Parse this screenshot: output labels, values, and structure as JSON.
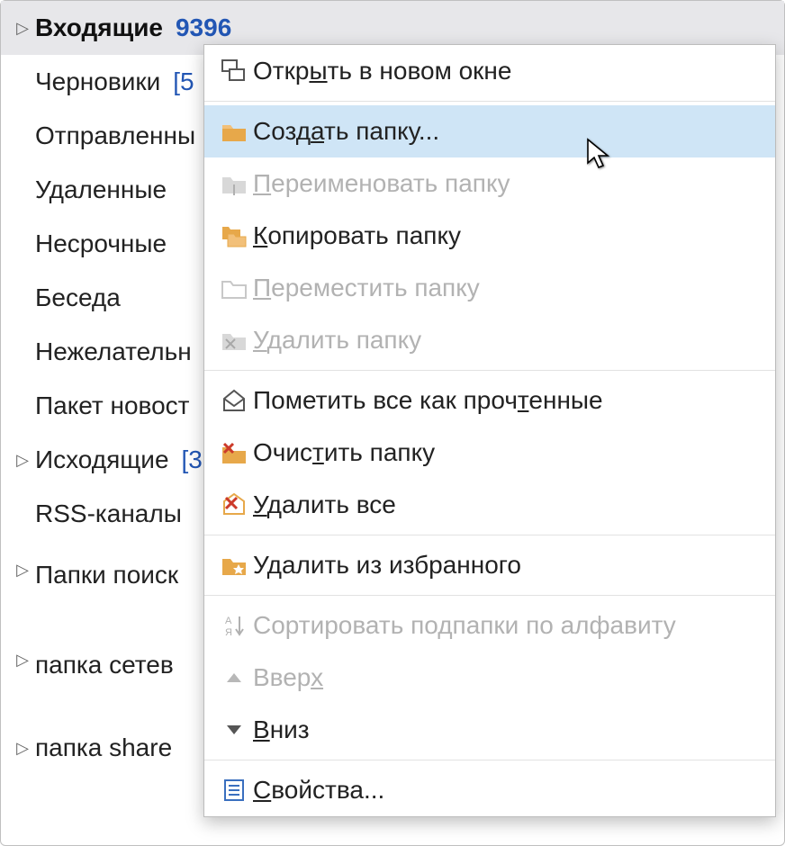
{
  "folders": [
    {
      "name": "Входящие",
      "count": "9396",
      "expand": true,
      "bold": true,
      "selected": true,
      "countBold": true
    },
    {
      "name": "Черновики",
      "count": "[5",
      "expand": false
    },
    {
      "name": "Отправленны",
      "count": "",
      "expand": false
    },
    {
      "name": "Удаленные",
      "count": "",
      "expand": false
    },
    {
      "name": "Несрочные",
      "count": "",
      "expand": false
    },
    {
      "name": "Беседа",
      "count": "",
      "expand": false
    },
    {
      "name": "Нежелательн",
      "count": "",
      "expand": false
    },
    {
      "name": "Пакет новост",
      "count": "",
      "expand": false
    },
    {
      "name": "Исходящие",
      "count": "[3",
      "expand": true
    },
    {
      "name": "RSS-каналы",
      "count": "",
      "expand": false
    },
    {
      "name": "Папки поиск",
      "count": "",
      "expand": true,
      "tall": true
    },
    {
      "name": "папка сетев",
      "count": "",
      "expand": true,
      "tall": true
    },
    {
      "name": "папка share",
      "count": "",
      "expand": true
    }
  ],
  "menu": {
    "open": {
      "label": "Открыть в новом окне",
      "u": 4
    },
    "create": {
      "label": "Создать папку...",
      "u": 4
    },
    "rename": {
      "label": "Переименовать папку",
      "u": 0
    },
    "copy": {
      "label": "Копировать папку",
      "u": 0
    },
    "move": {
      "label": "Переместить папку",
      "u": 0
    },
    "delete": {
      "label": "Удалить папку",
      "u": 0
    },
    "markread": {
      "label": "Пометить все как прочтенные",
      "u": 21
    },
    "clean": {
      "label": "Очистить папку",
      "u": 4
    },
    "delall": {
      "label": "Удалить все",
      "u": 0
    },
    "removefav": {
      "label": "Удалить из избранного",
      "u": -1
    },
    "sort": {
      "label": "Сортировать подпапки по алфавиту",
      "u": -1
    },
    "up": {
      "label": "Вверх",
      "u": 4
    },
    "down": {
      "label": "Вниз",
      "u": 0
    },
    "props": {
      "label": "Свойства...",
      "u": 0
    }
  }
}
